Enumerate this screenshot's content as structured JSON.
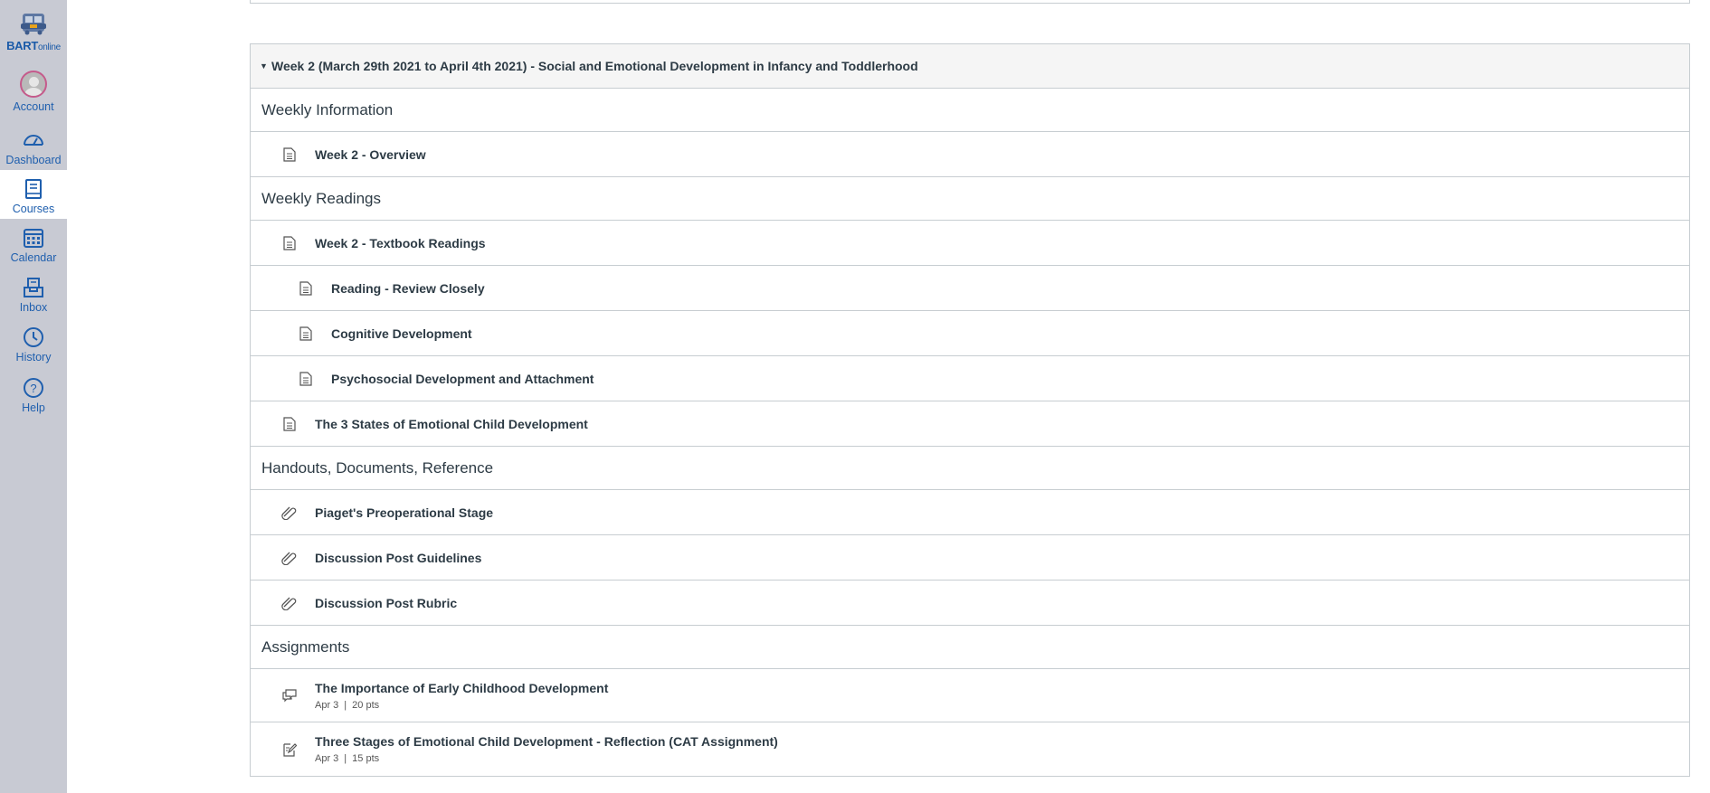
{
  "nav": {
    "logo_main": "BART",
    "logo_sub": "online",
    "items": [
      {
        "label": "Account",
        "icon": "avatar"
      },
      {
        "label": "Dashboard",
        "icon": "dashboard-icon"
      },
      {
        "label": "Courses",
        "icon": "courses-icon"
      },
      {
        "label": "Calendar",
        "icon": "calendar-icon"
      },
      {
        "label": "Inbox",
        "icon": "inbox-icon"
      },
      {
        "label": "History",
        "icon": "history-icon"
      },
      {
        "label": "Help",
        "icon": "help-icon"
      }
    ],
    "active": "Courses"
  },
  "module": {
    "title": "Week 2 (March 29th 2021 to April 4th 2021) - Social and Emotional Development in Infancy and Toddlerhood",
    "sections": [
      {
        "header": "Weekly Information",
        "items": [
          {
            "title": "Week 2 - Overview",
            "type": "page"
          }
        ]
      },
      {
        "header": "Weekly Readings",
        "items": [
          {
            "title": "Week 2 - Textbook Readings",
            "type": "page"
          },
          {
            "title": "Reading - Review Closely",
            "type": "page",
            "indent": 2
          },
          {
            "title": "Cognitive Development",
            "type": "page",
            "indent": 2
          },
          {
            "title": "Psychosocial Development and Attachment",
            "type": "page",
            "indent": 2
          },
          {
            "title": "The 3 States of Emotional Child Development",
            "type": "page"
          }
        ]
      },
      {
        "header": "Handouts, Documents, Reference",
        "items": [
          {
            "title": "Piaget's Preoperational Stage",
            "type": "attachment"
          },
          {
            "title": "Discussion Post Guidelines",
            "type": "attachment"
          },
          {
            "title": "Discussion Post Rubric",
            "type": "attachment"
          }
        ]
      },
      {
        "header": "Assignments",
        "items": [
          {
            "title": "The Importance of Early Childhood Development",
            "type": "discussion",
            "due": "Apr 3",
            "points": "20 pts"
          },
          {
            "title": "Three Stages of Emotional Child Development - Reflection (CAT Assignment)",
            "type": "assignment",
            "due": "Apr 3",
            "points": "15 pts"
          }
        ]
      }
    ]
  },
  "colors": {
    "nav_bg": "#c8cad3",
    "nav_link": "#1f5fae",
    "border": "#c7cdd1",
    "header_bg": "#f5f5f5",
    "text": "#2d3b45"
  }
}
